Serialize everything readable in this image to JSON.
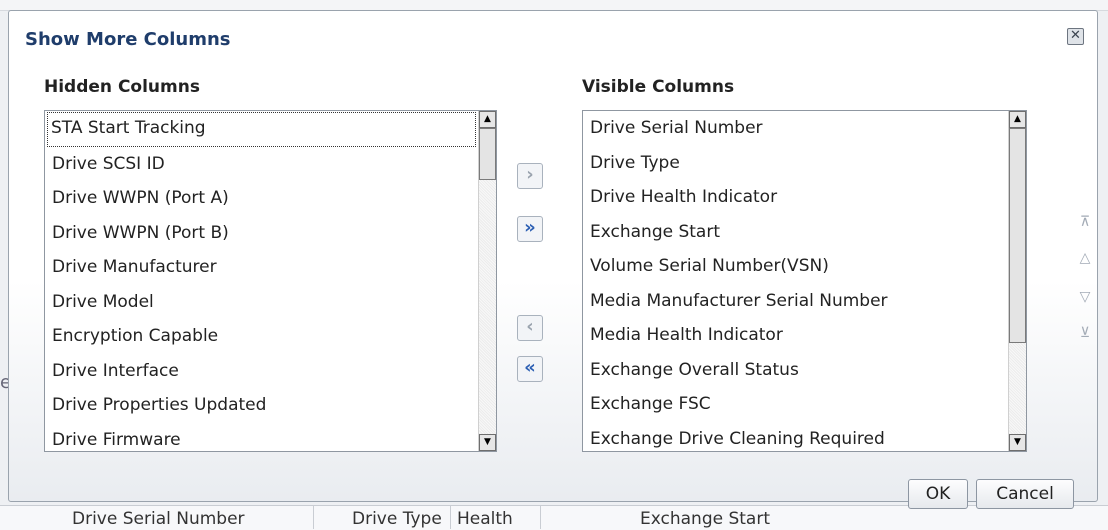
{
  "background": {
    "bottom_headers": [
      "Drive Serial Number",
      "Drive Type",
      "Health",
      "Exchange Start"
    ],
    "left_fragment": "e"
  },
  "dialog": {
    "title": "Show More Columns",
    "close_icon": "close-icon",
    "hidden": {
      "label": "Hidden Columns",
      "items": [
        "STA Start Tracking",
        "Drive SCSI ID",
        "Drive WWPN (Port A)",
        "Drive WWPN (Port B)",
        "Drive Manufacturer",
        "Drive Model",
        "Encryption Capable",
        "Drive Interface",
        "Drive Properties Updated",
        "Drive Firmware"
      ],
      "focused_index": 0
    },
    "visible": {
      "label": "Visible Columns",
      "items": [
        "Drive Serial Number",
        "Drive Type",
        "Drive Health Indicator",
        "Exchange Start",
        "Volume Serial Number(VSN)",
        "Media Manufacturer Serial Number",
        "Media Health Indicator",
        "Exchange Overall Status",
        "Exchange FSC",
        "Exchange Drive Cleaning Required"
      ]
    },
    "move_buttons": {
      "move_right": {
        "icon": "chevron-right-icon",
        "glyph": "›",
        "enabled": false
      },
      "move_all_right": {
        "icon": "double-chevron-right-icon",
        "glyph": "»",
        "enabled": true
      },
      "move_left": {
        "icon": "chevron-left-icon",
        "glyph": "‹",
        "enabled": false
      },
      "move_all_left": {
        "icon": "double-chevron-left-icon",
        "glyph": "«",
        "enabled": true
      }
    },
    "order_buttons": {
      "move_top": {
        "icon": "move-to-top-icon",
        "glyph": "⊼"
      },
      "move_up": {
        "icon": "move-up-icon",
        "glyph": "△"
      },
      "move_down": {
        "icon": "move-down-icon",
        "glyph": "▽"
      },
      "move_bottom": {
        "icon": "move-to-bottom-icon",
        "glyph": "⊻"
      }
    },
    "ok_label": "OK",
    "cancel_label": "Cancel"
  }
}
